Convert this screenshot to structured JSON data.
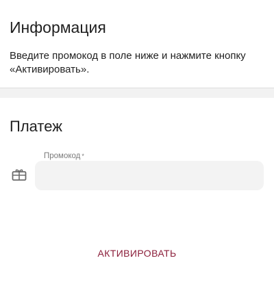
{
  "info": {
    "title": "Информация",
    "text": "Введите промокод в поле ниже и нажмите кнопку «Активировать»."
  },
  "payment": {
    "title": "Платеж",
    "promo_label": "Промокод",
    "required_mark": "*",
    "promo_value": "",
    "promo_icon": "gift-card-icon",
    "activate_label": "АКТИВИРОВАТЬ"
  },
  "colors": {
    "accent": "#8b1e3a",
    "background": "#f2f2f2",
    "input_fill": "#f3f3f3"
  }
}
